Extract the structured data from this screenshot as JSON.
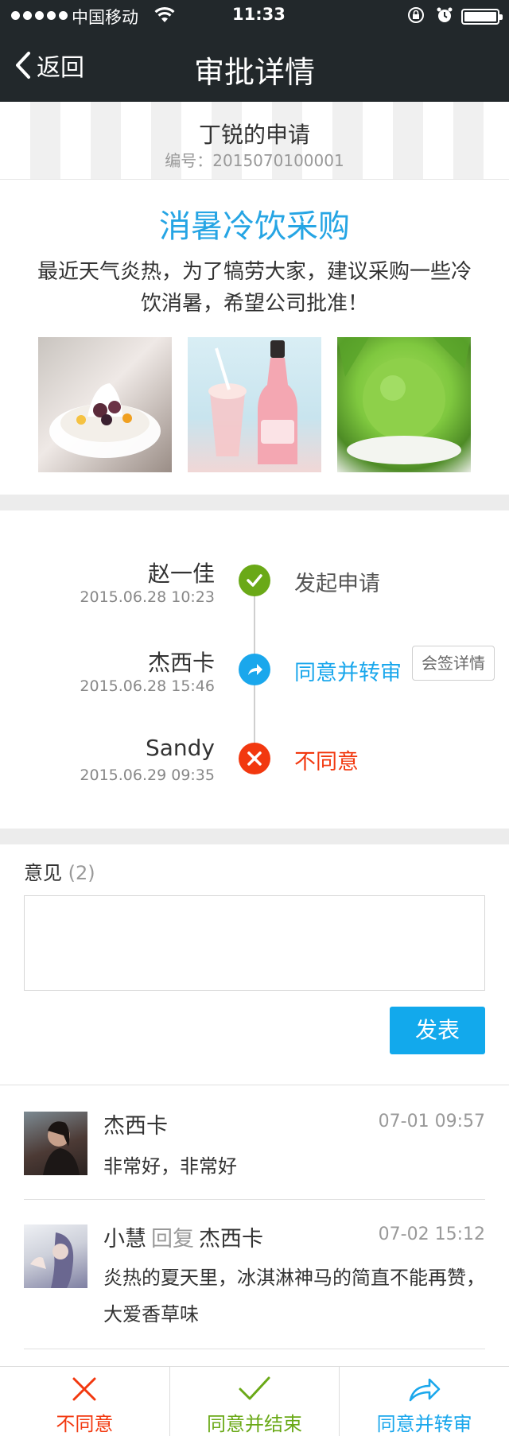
{
  "status_bar": {
    "carrier": "中国移动",
    "time": "11:33"
  },
  "nav": {
    "back_label": "返回",
    "title": "审批详情"
  },
  "header": {
    "applicant_title": "丁锐的申请",
    "serial": "编号：2015070100001"
  },
  "request": {
    "title": "消暑冷饮采购",
    "body": "最近天气炎热，为了犒劳大家，建议采购一些冷饮消暑，希望公司批准！",
    "photos": [
      "ice-cream-dessert",
      "pink-milkshake-bottle",
      "green-tea-ice-cream"
    ]
  },
  "timeline": [
    {
      "name": "赵一佳",
      "date": "2015.06.28 10:23",
      "action": "发起申请",
      "status": "start",
      "color": "#6aa917"
    },
    {
      "name": "杰西卡",
      "date": "2015.06.28 15:46",
      "action": "同意并转审",
      "status": "forward",
      "color": "#1aa7ec",
      "extra_button": "会签详情"
    },
    {
      "name": "Sandy",
      "date": "2015.06.29 09:35",
      "action": "不同意",
      "status": "reject",
      "color": "#f2380f"
    }
  ],
  "opinion": {
    "label": "意见",
    "count": "(2)",
    "input_value": "",
    "publish_label": "发表"
  },
  "comments": [
    {
      "name": "杰西卡",
      "reply_word": "",
      "reply_to": "",
      "time": "07-01 09:57",
      "text": "非常好，非常好"
    },
    {
      "name": "小慧",
      "reply_word": "回复",
      "reply_to": "杰西卡",
      "time": "07-02 15:12",
      "text": "炎热的夏天里，冰淇淋神马的简直不能再赞，大爱香草味"
    }
  ],
  "bottom_bar": {
    "reject_label": "不同意",
    "approve_end_label": "同意并结束",
    "approve_forward_label": "同意并转审"
  },
  "colors": {
    "accent_blue": "#26a5e4",
    "approve_green": "#6aa917",
    "reject_red": "#f2380f",
    "nav_dark": "#22282b"
  }
}
